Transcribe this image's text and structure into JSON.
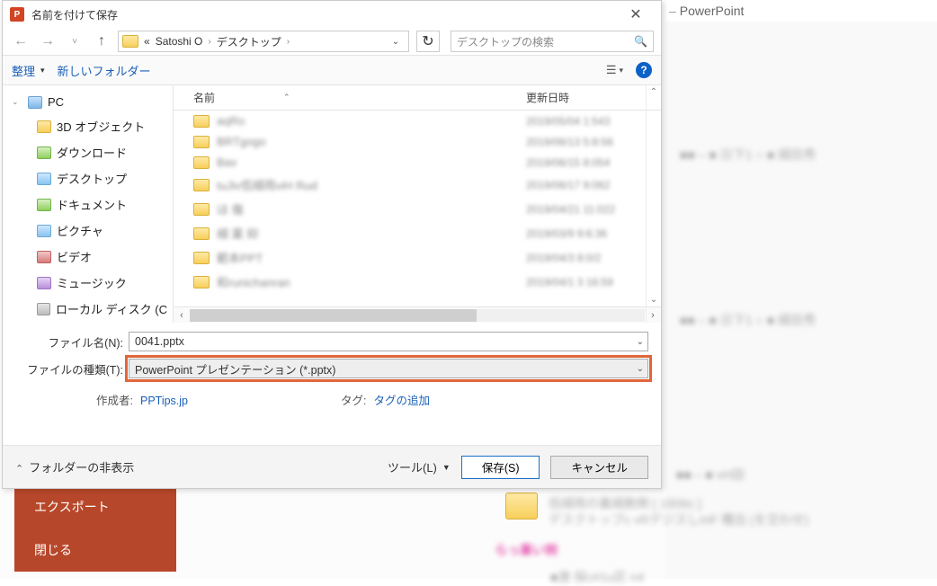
{
  "bg": {
    "app_name": "PowerPoint",
    "side_export": "エクスポート",
    "side_close": "閉じる"
  },
  "dialog": {
    "title": "名前を付けて保存",
    "path": {
      "p0": "«",
      "p1": "Satoshi O",
      "p2": "デスクトップ"
    },
    "search_placeholder": "デスクトップの検索",
    "toolbar": {
      "organize": "整理",
      "new_folder": "新しいフォルダー"
    },
    "tree": {
      "pc": "PC",
      "obj3d": "3D オブジェクト",
      "downloads": "ダウンロード",
      "desktop": "デスクトップ",
      "documents": "ドキュメント",
      "pictures": "ピクチャ",
      "videos": "ビデオ",
      "music": "ミュージック",
      "localdisk": "ローカル ディスク (C"
    },
    "columns": {
      "name": "名前",
      "date": "更新日時"
    },
    "files": [
      {
        "name": "aqRo",
        "date": "2019/05/04 1:543"
      },
      {
        "name": "BRTgogo",
        "date": "2019/06/13 5:8:56"
      },
      {
        "name": "Bav",
        "date": "2019/06/15 8:054"
      },
      {
        "name": "tuJiv低細雨viH Rud",
        "date": "2019/06/17 9:062"
      },
      {
        "name": "ほ 傷",
        "date": "2019/04/21 11:022"
      },
      {
        "name": "細 薬 抑",
        "date": "2019/03/9 9:6:36"
      },
      {
        "name": "範本PPT",
        "date": "2019/04/3 8:0/2"
      },
      {
        "name": "和runichanran",
        "date": "2019/04/1 3 16:59"
      }
    ],
    "form": {
      "filename_label": "ファイル名(N):",
      "filename_value": "0041.pptx",
      "filetype_label": "ファイルの種類(T):",
      "filetype_value": "PowerPoint プレゼンテーション (*.pptx)",
      "author_label": "作成者:",
      "author_value": "PPTips.jp",
      "tag_label": "タグ:",
      "tag_value": "タグの追加"
    },
    "footer": {
      "hide_folders": "フォルダーの非表示",
      "tools": "ツール(L)",
      "save": "保存(S)",
      "cancel": "キャンセル"
    }
  }
}
